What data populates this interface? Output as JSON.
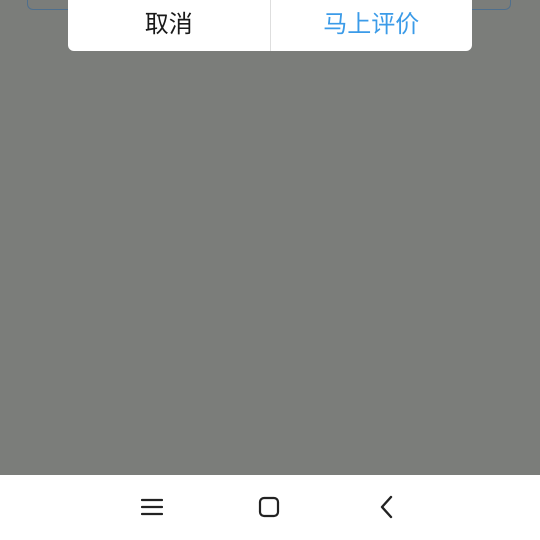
{
  "dialog": {
    "cancel_label": "取消",
    "confirm_label": "马上评价"
  },
  "navbar": {
    "icons": [
      "menu-icon",
      "home-icon",
      "back-icon"
    ]
  },
  "colors": {
    "overlay": "#7b7d7a",
    "confirm_text": "#3b9be8",
    "cancel_text": "#1a1a1a",
    "nav_background": "#ffffff"
  }
}
